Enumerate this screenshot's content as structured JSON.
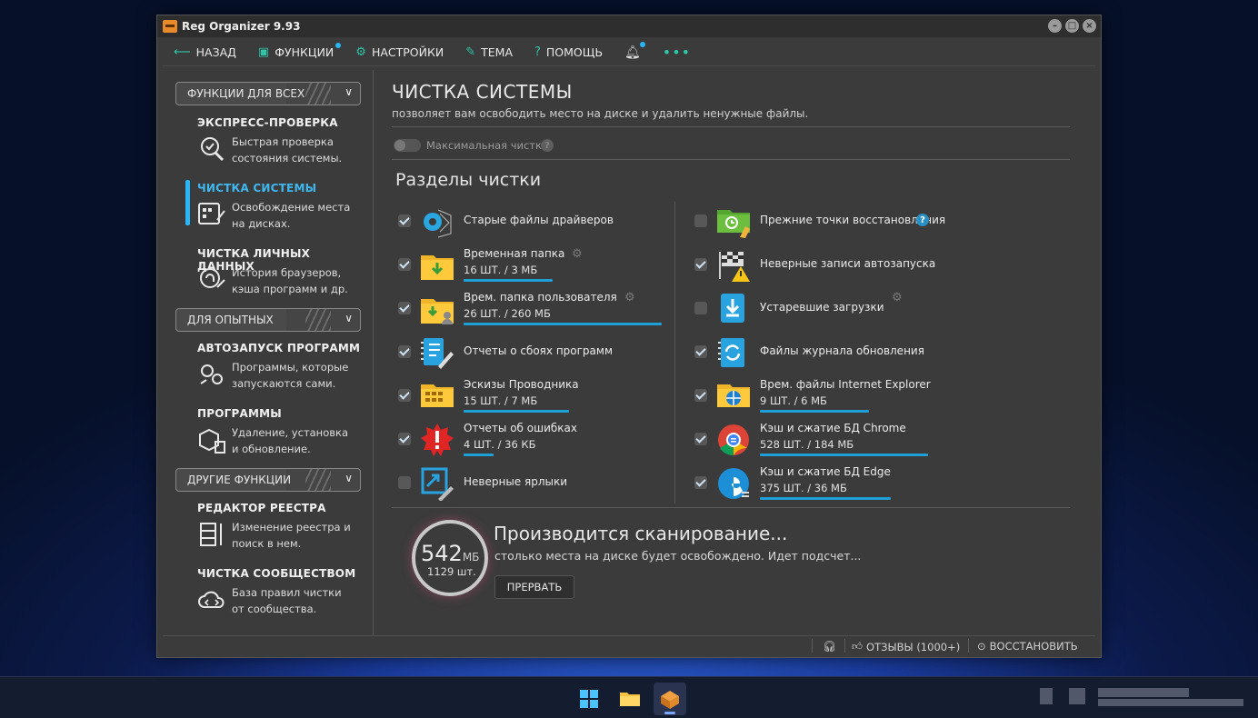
{
  "window": {
    "title": "Reg Organizer 9.93"
  },
  "menu": {
    "back": "НАЗАД",
    "functions": "ФУНКЦИИ",
    "settings": "НАСТРОЙКИ",
    "theme": "ТЕМА",
    "help": "ПОМОЩЬ"
  },
  "sidebar": {
    "sections": [
      {
        "label": "ФУНКЦИИ ДЛЯ ВСЕХ"
      },
      {
        "label": "ДЛЯ ОПЫТНЫХ"
      },
      {
        "label": "ДРУГИЕ ФУНКЦИИ"
      }
    ],
    "items": [
      {
        "title": "ЭКСПРЕСС-ПРОВЕРКА",
        "desc1": "Быстрая проверка",
        "desc2": "состояния системы."
      },
      {
        "title": "ЧИСТКА СИСТЕМЫ",
        "desc1": "Освобождение места",
        "desc2": "на дисках.",
        "active": true
      },
      {
        "title": "ЧИСТКА ЛИЧНЫХ ДАННЫХ",
        "desc1": "История браузеров,",
        "desc2": "кэша программ и др."
      },
      {
        "title": "АВТОЗАПУСК ПРОГРАММ",
        "desc1": "Программы, которые",
        "desc2": "запускаются сами."
      },
      {
        "title": "ПРОГРАММЫ",
        "desc1": "Удаление, установка",
        "desc2": "и обновление."
      },
      {
        "title": "РЕДАКТОР РЕЕСТРА",
        "desc1": "Изменение реестра и",
        "desc2": "поиск в нем."
      },
      {
        "title": "ЧИСТКА СООБЩЕСТВОМ",
        "desc1": "База правил чистки",
        "desc2": "от сообщества."
      }
    ]
  },
  "main": {
    "title": "ЧИСТКА СИСТЕМЫ",
    "subtitle": "позволяет вам освободить место на диске и удалить ненужные файлы.",
    "max_clean": "Максимальная чистка",
    "sections_title": "Разделы чистки",
    "left_items": [
      {
        "name": "Старые файлы драйверов",
        "checked": true
      },
      {
        "name": "Временная папка",
        "size": "16 ШТ. / 3 МБ",
        "checked": true,
        "fill": 0.45
      },
      {
        "name": "Врем. папка пользователя",
        "size": "26 ШТ. / 260 МБ",
        "checked": true,
        "fill": 1.0
      },
      {
        "name": "Отчеты о сбоях программ",
        "checked": true
      },
      {
        "name": "Эскизы Проводника",
        "size": "15 ШТ. / 7 МБ",
        "checked": true,
        "fill": 0.53
      },
      {
        "name": "Отчеты об ошибках",
        "size": "4 ШТ. / 36 КБ",
        "checked": true,
        "fill": 0.15
      },
      {
        "name": "Неверные ярлыки",
        "checked": false
      }
    ],
    "right_items": [
      {
        "name": "Прежние точки восстановления",
        "checked": false
      },
      {
        "name": "Неверные записи автозапуска",
        "checked": true
      },
      {
        "name": "Устаревшие загрузки",
        "checked": false
      },
      {
        "name": "Файлы журнала обновления",
        "checked": true
      },
      {
        "name": "Врем. файлы Internet Explorer",
        "size": "9 ШТ. / 6 МБ",
        "checked": true,
        "fill": 0.55
      },
      {
        "name": "Кэш и сжатие БД Chrome",
        "size": "528 ШТ. / 184 МБ",
        "checked": true,
        "fill": 0.85
      },
      {
        "name": "Кэш и сжатие БД Edge",
        "size": "375 ШТ. / 36 МБ",
        "checked": true,
        "fill": 0.66
      }
    ]
  },
  "scan": {
    "amount": "542",
    "unit": "МБ",
    "count": "1129 шт.",
    "heading": "Производится сканирование...",
    "text": "столько места на диске будет освобождено. Идет подсчет...",
    "stop_label": "ПРЕРВАТЬ"
  },
  "status": {
    "reviews": "ОТЗЫВЫ (1000+)",
    "restore": "ВОССТАНОВИТЬ"
  },
  "colors": {
    "accent": "#29b6f6",
    "teal": "#2ec4a8",
    "window_bg": "#3b3b3b",
    "bar": "#1e9fd6"
  }
}
